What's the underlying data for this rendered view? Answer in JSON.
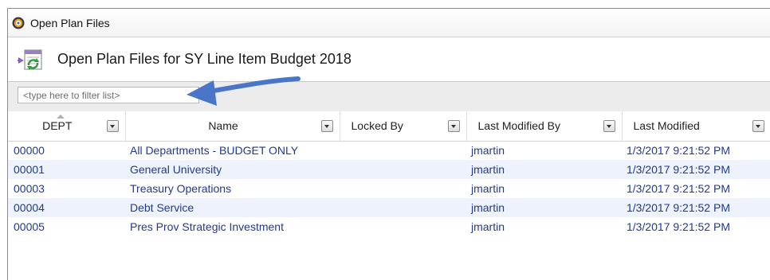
{
  "window": {
    "title": "Open Plan Files"
  },
  "header": {
    "title": "Open Plan Files for SY Line Item Budget 2018"
  },
  "filter": {
    "placeholder": "<type here to filter list>",
    "value": ""
  },
  "table": {
    "columns": [
      {
        "key": "dept",
        "label": "DEPT"
      },
      {
        "key": "name",
        "label": "Name"
      },
      {
        "key": "locked_by",
        "label": "Locked By"
      },
      {
        "key": "last_modified_by",
        "label": "Last Modified By"
      },
      {
        "key": "last_modified",
        "label": "Last Modified"
      }
    ],
    "rows": [
      {
        "dept": "00000",
        "name": "All Departments - BUDGET ONLY",
        "locked_by": "",
        "last_modified_by": "jmartin",
        "last_modified": "1/3/2017 9:21:52 PM"
      },
      {
        "dept": "00001",
        "name": "General University",
        "locked_by": "",
        "last_modified_by": "jmartin",
        "last_modified": "1/3/2017 9:21:52 PM"
      },
      {
        "dept": "00003",
        "name": "Treasury Operations",
        "locked_by": "",
        "last_modified_by": "jmartin",
        "last_modified": "1/3/2017 9:21:52 PM"
      },
      {
        "dept": "00004",
        "name": "Debt Service",
        "locked_by": "",
        "last_modified_by": "jmartin",
        "last_modified": "1/3/2017 9:21:52 PM"
      },
      {
        "dept": "00005",
        "name": "Pres Prov Strategic Investment",
        "locked_by": "",
        "last_modified_by": "jmartin",
        "last_modified": "1/3/2017 9:21:52 PM"
      }
    ]
  },
  "icons": {
    "app": "app-orb-icon",
    "header": "refresh-list-icon",
    "annotation": "annotation-arrow-icon",
    "dropdown": "chevron-down-icon"
  },
  "colors": {
    "row_text": "#1f3a93",
    "row_alt_bg": "#eef2fb",
    "annotation_arrow": "#4a76c9"
  }
}
